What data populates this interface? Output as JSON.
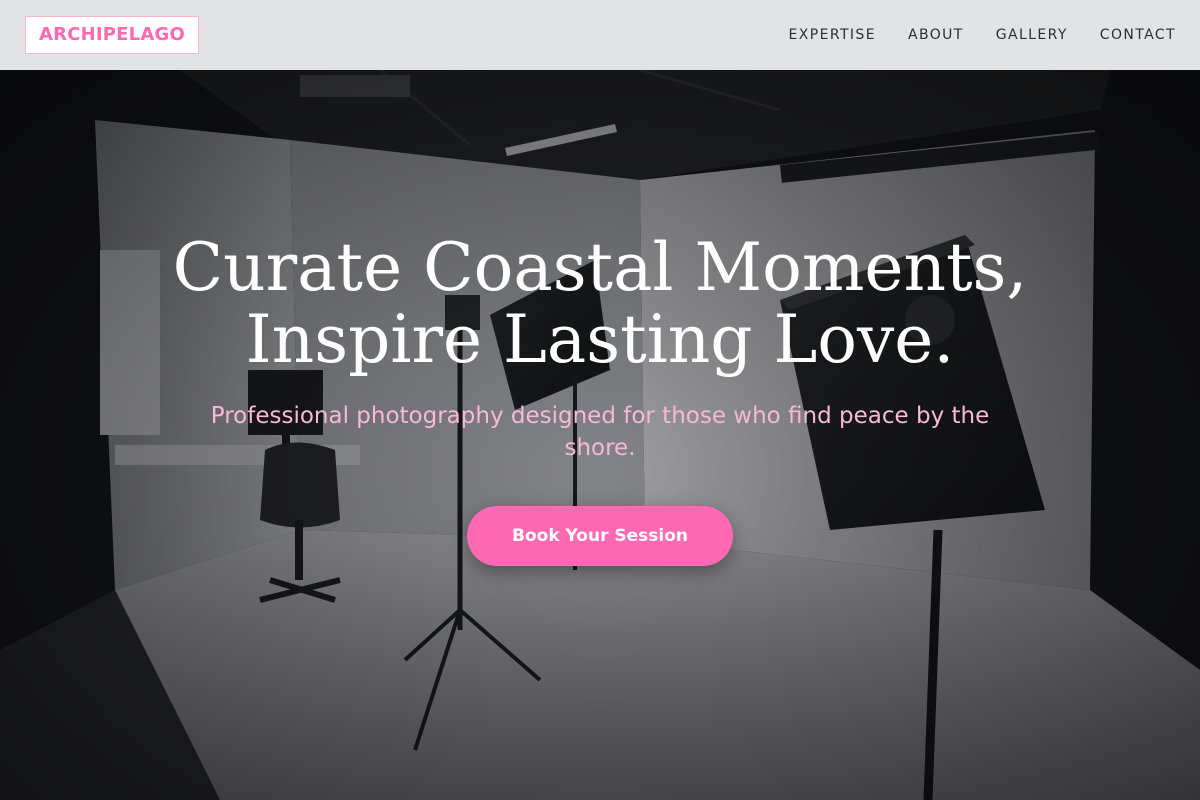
{
  "brand": {
    "logo_text": "ARCHIPELAGO"
  },
  "nav": {
    "items": [
      {
        "label": "EXPERTISE"
      },
      {
        "label": "ABOUT"
      },
      {
        "label": "GALLERY"
      },
      {
        "label": "CONTACT"
      }
    ]
  },
  "hero": {
    "headline_line1": "Curate Coastal Moments,",
    "headline_line2": "Inspire Lasting Love.",
    "subheadline": "Professional photography designed for those who find peace by the shore.",
    "cta_label": "Book Your Session",
    "background_image": "photo-studio-softbox-lights"
  },
  "colors": {
    "accent": "#ff69b4",
    "subheadline": "#f7b9d4",
    "header_bg": "#e2e3e5",
    "nav_text": "#2d2f33"
  }
}
